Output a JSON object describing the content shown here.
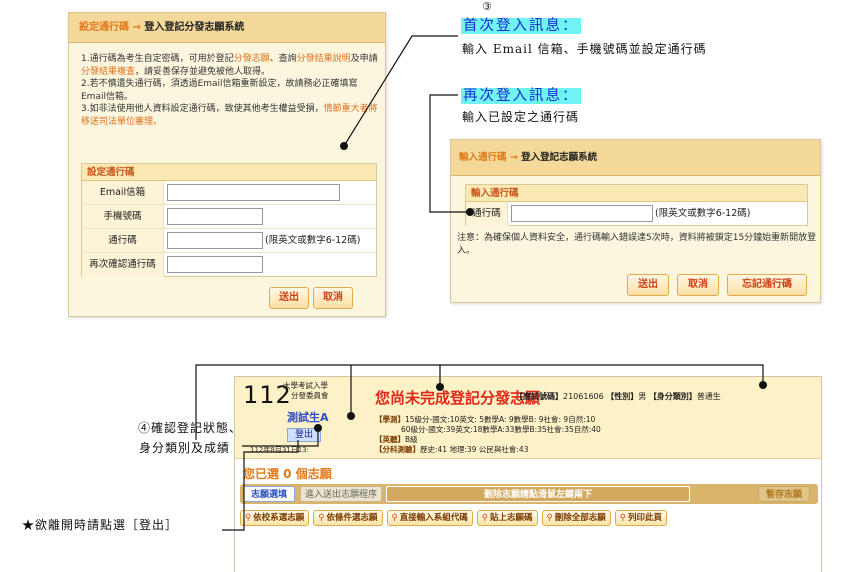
{
  "panel_set_password": {
    "title_prefix": "設定通行碼",
    "title_arrow": "→",
    "title_main": "登入登記分發志願系統",
    "notes": {
      "n1a": "1.通行碼為考生自定密碼，可用於登記",
      "n1b": "分發志願",
      "n1c": "、查詢",
      "n1d": "分發結果說明",
      "n1e": "及申請",
      "n1f": "分發結果複查",
      "n1g": "，請妥善保存並避免被他人取得。",
      "n2": "2.若不慎遺失通行碼，須透過Email信箱重新設定，故請務必正確填寫Email信箱。",
      "n3a": "3.如非法使用他人資料設定通行碼，致使其他考生權益受損，",
      "n3b": "情節重大者將移送司法單位審理。"
    },
    "form_title": "設定通行碼",
    "fields": {
      "email_label": "Email信箱",
      "phone_label": "手機號碼",
      "password_label": "通行碼",
      "password_hint": "(限英文或數字6-12碼)",
      "confirm_label": "再次確認通行碼"
    },
    "submit_label": "送出",
    "cancel_label": "取消"
  },
  "annotations": {
    "circle3": "③",
    "first_login_head": "首次登入訊息：",
    "first_login_body": "輸入 Email 信箱、手機號碼並設定通行碼",
    "again_login_head": "再次登入訊息：",
    "again_login_body": "輸入已設定之通行碼",
    "note4_line1": "④確認登記狀態、",
    "note4_line2": "身分類別及成績",
    "star_note": "★欲離開時請點選［登出］"
  },
  "panel_login": {
    "title_prefix": "輸入通行碼",
    "title_arrow": "→",
    "title_main": "登入登記志願系統",
    "form_title": "輸入通行碼",
    "password_label": "通行碼",
    "password_hint": "(限英文或數字6-12碼)",
    "note": "注意：為確保個人資料安全，通行碼輸入錯誤達5次時，資料將被鎖定15分鐘始重新開放登入。",
    "submit_label": "送出",
    "cancel_label": "取消",
    "forgot_label": "忘記通行碼"
  },
  "panel_status": {
    "logo_number": "112",
    "logo_line1": "大學考試入學",
    "logo_line2": "分發委員會",
    "user_name": "測試生A",
    "logout_label": "登出",
    "login_time": "112年8月31日13:",
    "status_title": "您尚未完成登記分發志願",
    "meta_id_label": "【應試號碼】",
    "meta_id_value": "21061606",
    "meta_gender_label": "【性別】",
    "meta_gender_value": "男",
    "meta_type_label": "【身分類別】",
    "meta_type_value": "普通生",
    "score_line1_label": "【學測】",
    "score_line1": "15級分-國文:10英文: 5數學A: 9數學B: 9社會: 9自然:10",
    "score_line2": "60級分-國文:39英文:18數學A:33數學B:35社會:35自然:40",
    "score_line3_label": "【英聽】",
    "score_line3": "B級",
    "score_line4_label": "【分科測驗】",
    "score_line4": "歷史:41 地理:39 公民與社會:43",
    "selected_title": "您已選 0 個志願",
    "tabs": {
      "t1": "志願選填",
      "t2": "進入送出志願程序",
      "t3": "刪除志願請點滑鼠左鍵兩下",
      "t4": "暫存志願"
    },
    "tools": {
      "b1": "依校系選志願",
      "b2": "依條件選志願",
      "b3": "直接輸入系組代碼",
      "b4": "貼上志願碼",
      "b5": "刪除全部志願",
      "b6": "列印此頁"
    }
  }
}
